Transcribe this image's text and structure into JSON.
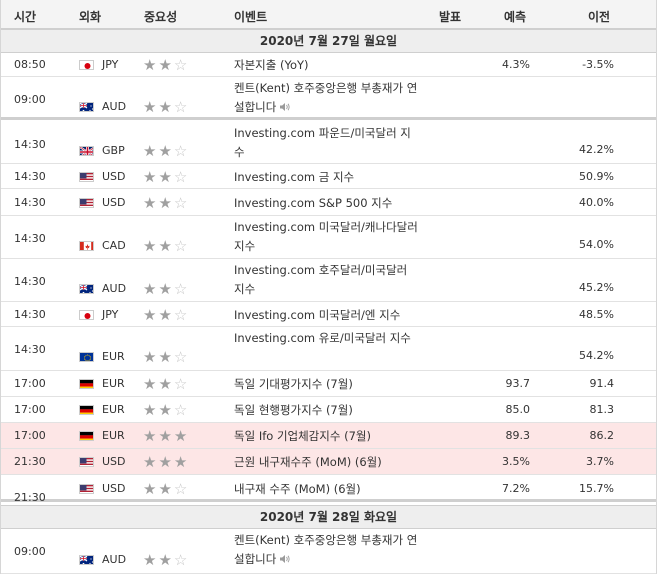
{
  "header": {
    "time": "시간",
    "currency": "외화",
    "importance": "중요성",
    "event": "이벤트",
    "actual": "발표",
    "forecast": "예측",
    "previous": "이전"
  },
  "days": [
    {
      "label": "2020년 7월 27일 월요일"
    },
    {
      "label": "2020년 7월 28일 화요일"
    }
  ],
  "rows": [
    {
      "time": "08:50",
      "flag": "jp",
      "currency": "JPY",
      "stars": 2,
      "event": "자본지출 (YoY)",
      "forecast": "4.3%",
      "previous": "-3.5%",
      "speaker": false,
      "highlight": false
    },
    {
      "time": "09:00",
      "flag": "au",
      "currency": "AUD",
      "stars": 2,
      "event": "켄트(Kent) 호주중앙은행 부총재가 연설합니다",
      "forecast": "",
      "previous": "",
      "speaker": true,
      "highlight": false
    },
    {
      "time": "14:30",
      "flag": "gb",
      "currency": "GBP",
      "stars": 2,
      "event": "Investing.com 파운드/미국달러 지수",
      "forecast": "",
      "previous": "42.2%",
      "speaker": false,
      "highlight": false
    },
    {
      "time": "14:30",
      "flag": "us",
      "currency": "USD",
      "stars": 2,
      "event": "Investing.com 금 지수",
      "forecast": "",
      "previous": "50.9%",
      "speaker": false,
      "highlight": false
    },
    {
      "time": "14:30",
      "flag": "us",
      "currency": "USD",
      "stars": 2,
      "event": "Investing.com S&P 500 지수",
      "forecast": "",
      "previous": "40.0%",
      "speaker": false,
      "highlight": false
    },
    {
      "time": "14:30",
      "flag": "ca",
      "currency": "CAD",
      "stars": 2,
      "event": "Investing.com 미국달러/캐나다달러 지수",
      "forecast": "",
      "previous": "54.0%",
      "speaker": false,
      "highlight": false
    },
    {
      "time": "14:30",
      "flag": "au",
      "currency": "AUD",
      "stars": 2,
      "event": "Investing.com 호주달러/미국달러 지수",
      "forecast": "",
      "previous": "45.2%",
      "speaker": false,
      "highlight": false
    },
    {
      "time": "14:30",
      "flag": "jp",
      "currency": "JPY",
      "stars": 2,
      "event": "Investing.com 미국달러/엔 지수",
      "forecast": "",
      "previous": "48.5%",
      "speaker": false,
      "highlight": false
    },
    {
      "time": "14:30",
      "flag": "eu",
      "currency": "EUR",
      "stars": 2,
      "event": "Investing.com 유로/미국달러 지수",
      "forecast": "",
      "previous": "54.2%",
      "speaker": false,
      "highlight": false
    },
    {
      "time": "17:00",
      "flag": "de",
      "currency": "EUR",
      "stars": 2,
      "event": "독일 기대평가지수 (7월)",
      "forecast": "93.7",
      "previous": "91.4",
      "speaker": false,
      "highlight": false
    },
    {
      "time": "17:00",
      "flag": "de",
      "currency": "EUR",
      "stars": 2,
      "event": "독일 현행평가지수 (7월)",
      "forecast": "85.0",
      "previous": "81.3",
      "speaker": false,
      "highlight": false
    },
    {
      "time": "17:00",
      "flag": "de",
      "currency": "EUR",
      "stars": 3,
      "event": "독일 Ifo 기업체감지수 (7월)",
      "forecast": "89.3",
      "previous": "86.2",
      "speaker": false,
      "highlight": true
    },
    {
      "time": "21:30",
      "flag": "us",
      "currency": "USD",
      "stars": 3,
      "event": "근원 내구재수주 (MoM) (6월)",
      "forecast": "3.5%",
      "previous": "3.7%",
      "speaker": false,
      "highlight": true
    },
    {
      "time": "21:30",
      "flag": "us",
      "currency": "USD",
      "stars": 2,
      "event": "내구재 수주 (MoM) (6월)",
      "forecast": "7.2%",
      "previous": "15.7%",
      "speaker": false,
      "highlight": false
    },
    {
      "time": "09:00",
      "flag": "au",
      "currency": "AUD",
      "stars": 2,
      "event": "켄트(Kent) 호주중앙은행 부총재가 연설합니다",
      "forecast": "",
      "previous": "",
      "speaker": true,
      "highlight": false
    }
  ]
}
